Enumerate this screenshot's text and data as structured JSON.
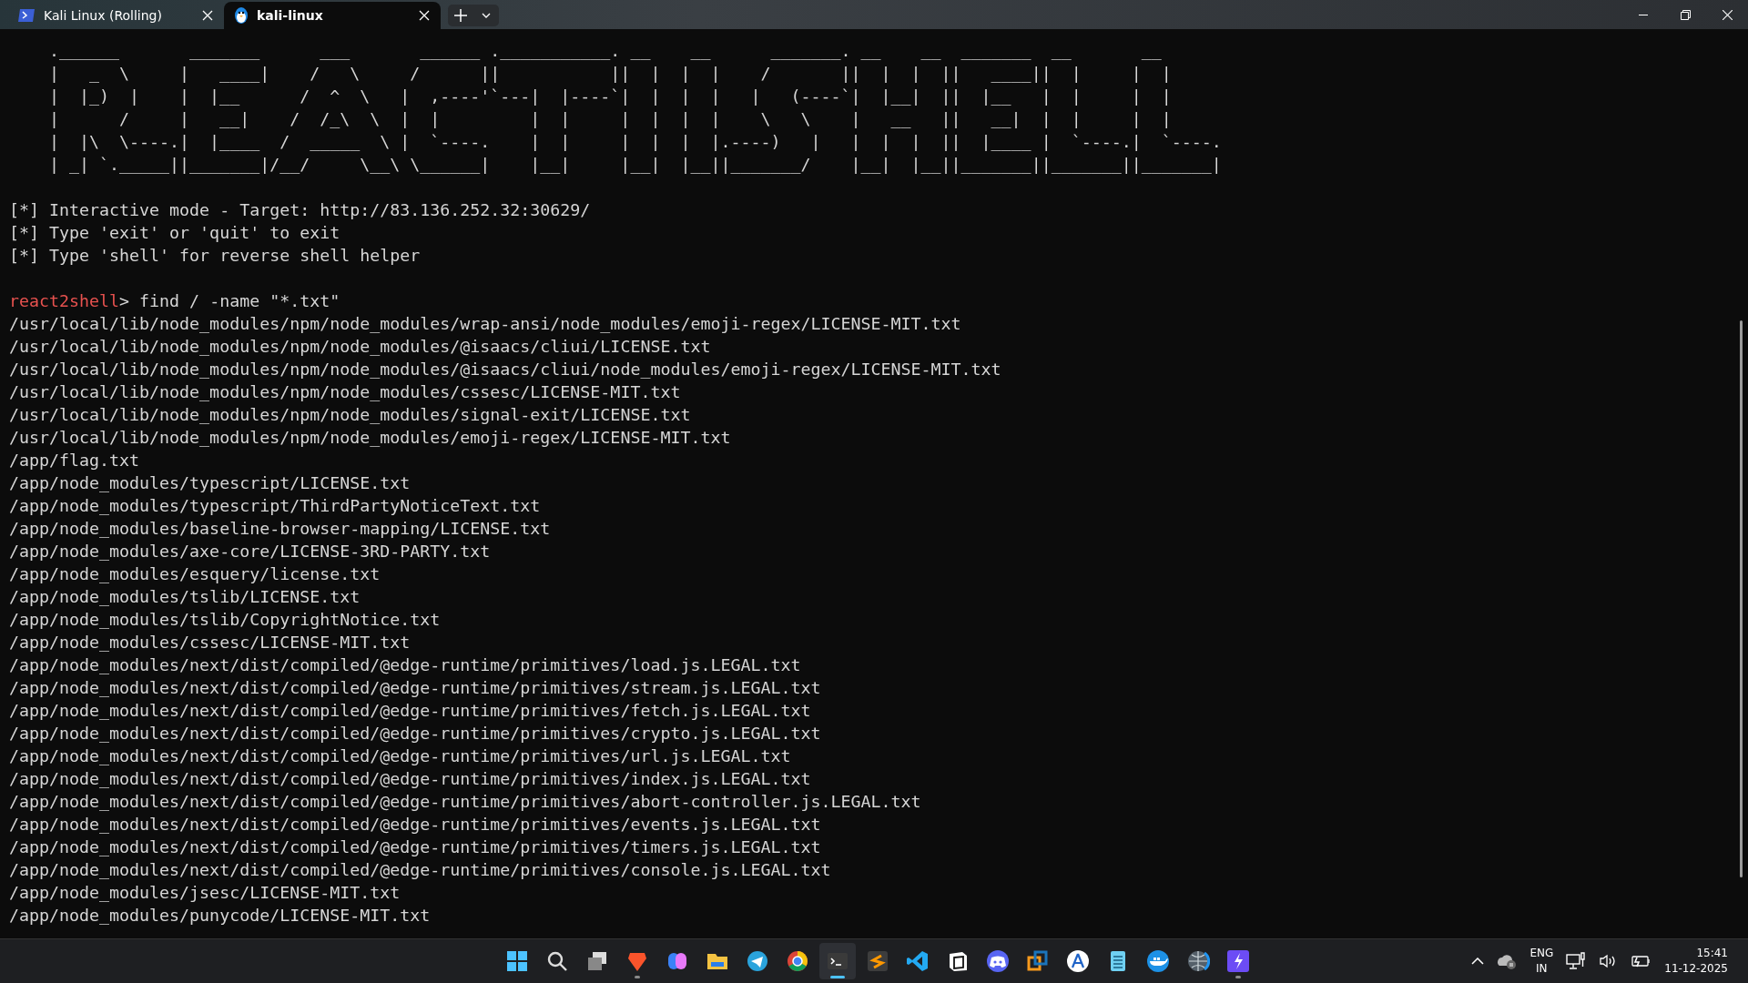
{
  "tabs": [
    {
      "label": "Kali Linux (Rolling)",
      "kind": "shell",
      "selected": false
    },
    {
      "label": "kali-linux",
      "kind": "penguin",
      "selected": true
    }
  ],
  "terminal": {
    "banner_art": [
      ".______       _______      ___       ______ .___________. __    __      _______. __    __  _______  __       __",
      "|   _  \\     |   ____|    /   \\     /      ||           ||  |  |  |    /       ||  |  |  ||   ____||  |     |  |",
      "|  |_)  |    |  |__      /  ^  \\   |  ,----'`---|  |----`|  |  |  |   |   (----`|  |__|  ||  |__   |  |     |  |",
      "|      /     |   __|    /  /_\\  \\  |  |         |  |     |  |  |  |    \\   \\    |   __   ||   __|  |  |     |  |",
      "|  |\\  \\----.|  |____  /  _____  \\ |  `----.    |  |     |  |  |  |.----)   |   |  |  |  ||  |____ |  `----.|  `----.",
      "| _| `._____||_______|/__/     \\__\\ \\______|    |__|     |__|  |__||_______/    |__|  |__||_______||_______||_______|"
    ],
    "info_lines": [
      "[*] Interactive mode - Target: http://83.136.252.32:30629/",
      "[*] Type 'exit' or 'quit' to exit",
      "[*] Type 'shell' for reverse shell helper"
    ],
    "prompt": {
      "name": "react2shell",
      "command": "> find / -name \"*.txt\""
    },
    "output": [
      "/usr/local/lib/node_modules/npm/node_modules/wrap-ansi/node_modules/emoji-regex/LICENSE-MIT.txt",
      "/usr/local/lib/node_modules/npm/node_modules/@isaacs/cliui/LICENSE.txt",
      "/usr/local/lib/node_modules/npm/node_modules/@isaacs/cliui/node_modules/emoji-regex/LICENSE-MIT.txt",
      "/usr/local/lib/node_modules/npm/node_modules/cssesc/LICENSE-MIT.txt",
      "/usr/local/lib/node_modules/npm/node_modules/signal-exit/LICENSE.txt",
      "/usr/local/lib/node_modules/npm/node_modules/emoji-regex/LICENSE-MIT.txt",
      "/app/flag.txt",
      "/app/node_modules/typescript/LICENSE.txt",
      "/app/node_modules/typescript/ThirdPartyNoticeText.txt",
      "/app/node_modules/baseline-browser-mapping/LICENSE.txt",
      "/app/node_modules/axe-core/LICENSE-3RD-PARTY.txt",
      "/app/node_modules/esquery/license.txt",
      "/app/node_modules/tslib/LICENSE.txt",
      "/app/node_modules/tslib/CopyrightNotice.txt",
      "/app/node_modules/cssesc/LICENSE-MIT.txt",
      "/app/node_modules/next/dist/compiled/@edge-runtime/primitives/load.js.LEGAL.txt",
      "/app/node_modules/next/dist/compiled/@edge-runtime/primitives/stream.js.LEGAL.txt",
      "/app/node_modules/next/dist/compiled/@edge-runtime/primitives/fetch.js.LEGAL.txt",
      "/app/node_modules/next/dist/compiled/@edge-runtime/primitives/crypto.js.LEGAL.txt",
      "/app/node_modules/next/dist/compiled/@edge-runtime/primitives/url.js.LEGAL.txt",
      "/app/node_modules/next/dist/compiled/@edge-runtime/primitives/index.js.LEGAL.txt",
      "/app/node_modules/next/dist/compiled/@edge-runtime/primitives/abort-controller.js.LEGAL.txt",
      "/app/node_modules/next/dist/compiled/@edge-runtime/primitives/events.js.LEGAL.txt",
      "/app/node_modules/next/dist/compiled/@edge-runtime/primitives/timers.js.LEGAL.txt",
      "/app/node_modules/next/dist/compiled/@edge-runtime/primitives/console.js.LEGAL.txt",
      "/app/node_modules/jsesc/LICENSE-MIT.txt",
      "/app/node_modules/punycode/LICENSE-MIT.txt"
    ]
  },
  "taskbar": {
    "apps": [
      {
        "kind": "start",
        "running": false,
        "active": false
      },
      {
        "kind": "search",
        "running": false,
        "active": false
      },
      {
        "kind": "taskview",
        "running": false,
        "active": false
      },
      {
        "kind": "shield",
        "running": true,
        "active": false
      },
      {
        "kind": "swirl",
        "running": false,
        "active": false
      },
      {
        "kind": "folder",
        "running": false,
        "active": false
      },
      {
        "kind": "plane",
        "running": false,
        "active": false
      },
      {
        "kind": "ring",
        "running": false,
        "active": false
      },
      {
        "kind": "terminal",
        "running": true,
        "active": true
      },
      {
        "kind": "tile",
        "running": false,
        "active": false
      },
      {
        "kind": "ribbon",
        "running": false,
        "active": false
      },
      {
        "kind": "cube",
        "running": false,
        "active": false
      },
      {
        "kind": "chat",
        "running": false,
        "active": false
      },
      {
        "kind": "squares",
        "running": false,
        "active": false
      },
      {
        "kind": "compass",
        "running": false,
        "active": false
      },
      {
        "kind": "notepad",
        "running": false,
        "active": false
      },
      {
        "kind": "whale",
        "running": false,
        "active": false
      },
      {
        "kind": "globe",
        "running": false,
        "active": false
      },
      {
        "kind": "bolt",
        "running": true,
        "active": false
      }
    ],
    "language": "ENG",
    "region": "IN",
    "time": "15:41",
    "date": "11-12-2025"
  }
}
